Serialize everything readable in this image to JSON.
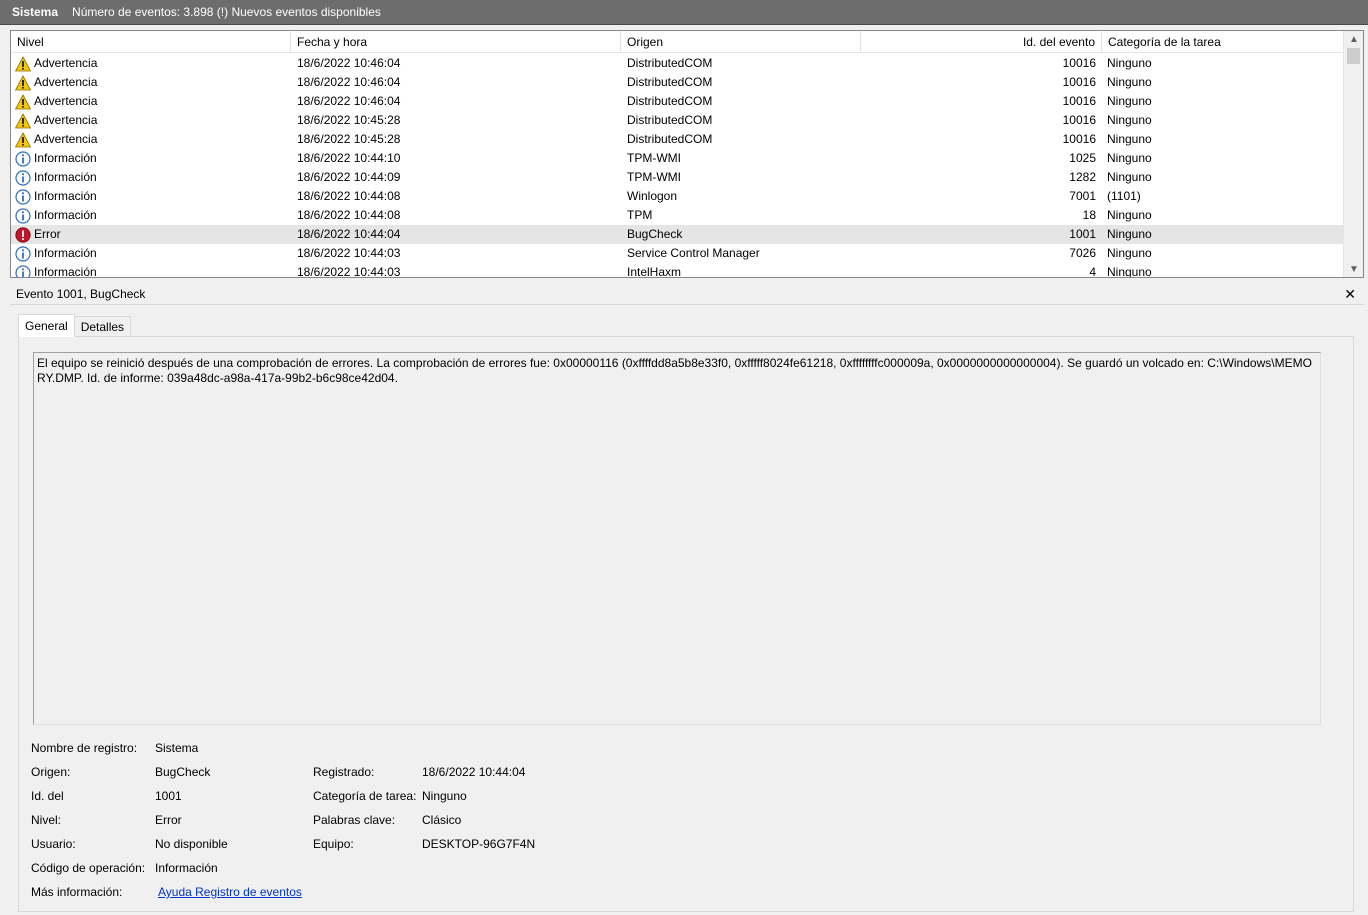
{
  "titlebar": {
    "title": "Sistema",
    "info": "Número de eventos: 3.898 (!) Nuevos eventos disponibles"
  },
  "columns": {
    "level": "Nivel",
    "date": "Fecha y hora",
    "source": "Origen",
    "event_id": "Id. del evento",
    "category": "Categoría de la tarea"
  },
  "events": [
    {
      "icon": "warning-icon",
      "level": "Advertencia",
      "date": "18/6/2022 10:46:04",
      "source": "DistributedCOM",
      "id": "10016",
      "category": "Ninguno"
    },
    {
      "icon": "warning-icon",
      "level": "Advertencia",
      "date": "18/6/2022 10:46:04",
      "source": "DistributedCOM",
      "id": "10016",
      "category": "Ninguno"
    },
    {
      "icon": "warning-icon",
      "level": "Advertencia",
      "date": "18/6/2022 10:46:04",
      "source": "DistributedCOM",
      "id": "10016",
      "category": "Ninguno"
    },
    {
      "icon": "warning-icon",
      "level": "Advertencia",
      "date": "18/6/2022 10:45:28",
      "source": "DistributedCOM",
      "id": "10016",
      "category": "Ninguno"
    },
    {
      "icon": "warning-icon",
      "level": "Advertencia",
      "date": "18/6/2022 10:45:28",
      "source": "DistributedCOM",
      "id": "10016",
      "category": "Ninguno"
    },
    {
      "icon": "info-icon",
      "level": "Información",
      "date": "18/6/2022 10:44:10",
      "source": "TPM-WMI",
      "id": "1025",
      "category": "Ninguno"
    },
    {
      "icon": "info-icon",
      "level": "Información",
      "date": "18/6/2022 10:44:09",
      "source": "TPM-WMI",
      "id": "1282",
      "category": "Ninguno"
    },
    {
      "icon": "info-icon",
      "level": "Información",
      "date": "18/6/2022 10:44:08",
      "source": "Winlogon",
      "id": "7001",
      "category": "(1101)"
    },
    {
      "icon": "info-icon",
      "level": "Información",
      "date": "18/6/2022 10:44:08",
      "source": "TPM",
      "id": "18",
      "category": "Ninguno"
    },
    {
      "icon": "error-icon",
      "level": "Error",
      "date": "18/6/2022 10:44:04",
      "source": "BugCheck",
      "id": "1001",
      "category": "Ninguno",
      "selected": true
    },
    {
      "icon": "info-icon",
      "level": "Información",
      "date": "18/6/2022 10:44:03",
      "source": "Service Control Manager",
      "id": "7026",
      "category": "Ninguno"
    },
    {
      "icon": "info-icon",
      "level": "Información",
      "date": "18/6/2022 10:44:03",
      "source": "IntelHaxm",
      "id": "4",
      "category": "Ninguno"
    }
  ],
  "detail": {
    "header": "Evento 1001, BugCheck",
    "close": "✕",
    "tabs": [
      "General",
      "Detalles"
    ],
    "description": "El equipo se reinició después de una comprobación de errores. La comprobación de errores fue: 0x00000116 (0xffffdd8a5b8e33f0, 0xfffff8024fe61218, 0xffffffffc000009a, 0x0000000000000004). Se guardó un volcado en: C:\\Windows\\MEMORY.DMP. Id. de informe: 039a48dc-a98a-417a-99b2-b6c98ce42d04.",
    "props": {
      "log_name_label": "Nombre de registro:",
      "log_name": "Sistema",
      "source_label": "Origen:",
      "source": "BugCheck",
      "logged_label": "Registrado:",
      "logged": "18/6/2022 10:44:04",
      "event_id_label": "Id. del",
      "event_id": "1001",
      "task_cat_label": "Categoría de tarea:",
      "task_cat": "Ninguno",
      "level_label": "Nivel:",
      "level": "Error",
      "keywords_label": "Palabras clave:",
      "keywords": "Clásico",
      "user_label": "Usuario:",
      "user": "No disponible",
      "computer_label": "Equipo:",
      "computer": "DESKTOP-96G7F4N",
      "opcode_label": "Código de operación:",
      "opcode": "Información",
      "more_info_label": "Más información:",
      "more_info_link": "Ayuda Registro de eventos"
    }
  },
  "colors": {
    "titlebar_bg": "#6d6d6d",
    "selected_row": "#e5e5e5",
    "link": "#0033cc",
    "warning": "#f5c800",
    "error": "#c0182a",
    "info": "#2f6fc0"
  }
}
